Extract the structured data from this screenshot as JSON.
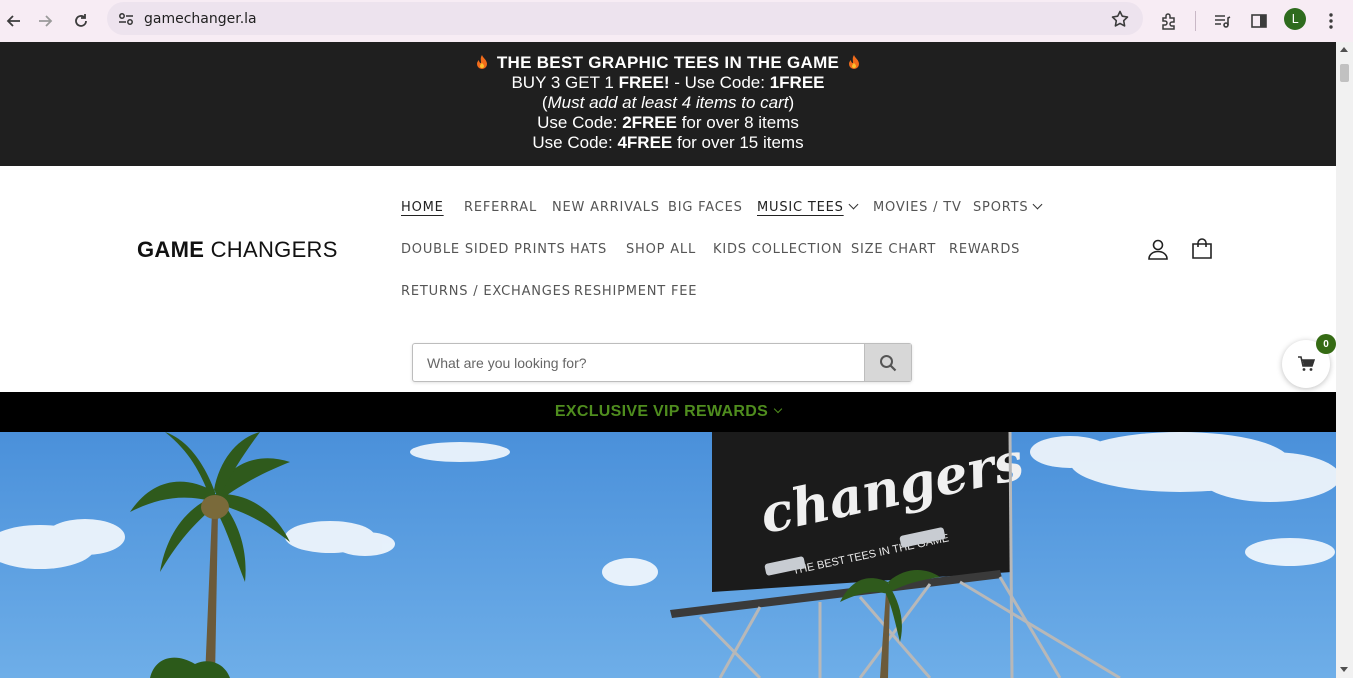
{
  "browser": {
    "url": "gamechanger.la",
    "profile_initial": "L",
    "icons": [
      "back-arrow-icon",
      "forward-arrow-icon",
      "reload-icon",
      "site-info-icon",
      "bookmark-star-icon",
      "extensions-icon",
      "media-queue-icon",
      "side-panel-icon",
      "more-vert-icon"
    ]
  },
  "announcement": {
    "line1": "THE BEST GRAPHIC TEES IN THE GAME",
    "line2_a": "BUY 3 GET 1 ",
    "line2_b": "FREE!",
    "line2_c": " - Use Code: ",
    "line2_d": "1FREE",
    "line3_open": "(",
    "line3_em": "Must add at least 4 items to cart",
    "line3_close": ")",
    "line4_a": "Use Code: ",
    "line4_b": "2FREE",
    "line4_c": " for over 8 items",
    "line5_a": "Use Code: ",
    "line5_b": "4FREE",
    "line5_c": " for over 15 items"
  },
  "header": {
    "logo_bold": "GAME",
    "logo_rest": " CHANGERS",
    "nav": {
      "home": "HOME",
      "referral": "REFERRAL",
      "new_arrivals": "NEW ARRIVALS",
      "big_faces": "BIG FACES",
      "music_tees": "MUSIC TEES",
      "movies_tv": "MOVIES / TV",
      "sports": "SPORTS",
      "double_sided": "DOUBLE SIDED PRINTS",
      "hats": "HATS",
      "shop_all": "SHOP ALL",
      "kids": "KIDS COLLECTION",
      "size_chart": "SIZE CHART",
      "rewards": "REWARDS",
      "returns": "RETURNS / EXCHANGES",
      "reshipment": "RESHIPMENT FEE"
    }
  },
  "search": {
    "placeholder": "What are you looking for?"
  },
  "cart": {
    "count": "0"
  },
  "vip": {
    "label": "EXCLUSIVE VIP REWARDS"
  },
  "hero": {
    "billboard_brand": "changers",
    "billboard_tagline": "THE BEST TEES IN THE GAME"
  },
  "colors": {
    "announce_bg": "#1f1f1f",
    "vip_green": "#4f8d1e",
    "badge_green": "#356b14",
    "sky": "#5a9ee0"
  }
}
